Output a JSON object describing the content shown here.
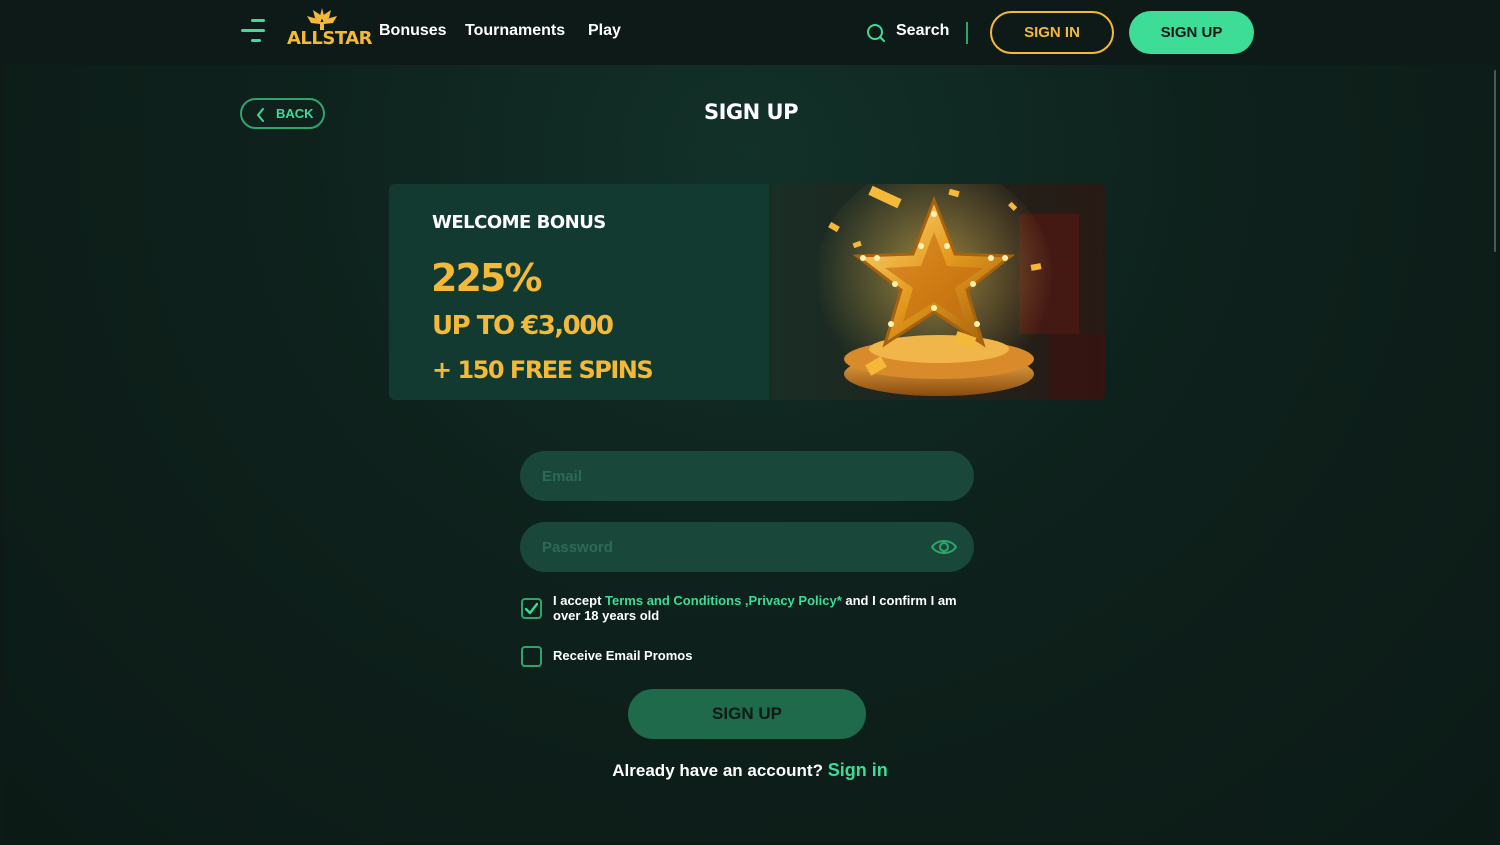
{
  "header": {
    "logo_text": "ALLSTAR",
    "nav": [
      "Bonuses",
      "Tournaments",
      "Play"
    ],
    "search_label": "Search",
    "sign_in_label": "SIGN IN",
    "sign_up_label": "SIGN UP"
  },
  "page": {
    "back_label": "BACK",
    "title": "SIGN UP"
  },
  "banner": {
    "title": "WELCOME BONUS",
    "percent": "225%",
    "amount": "UP TO €3,000",
    "spins": "+ 150 FREE SPINS"
  },
  "form": {
    "email_placeholder": "Email",
    "password_placeholder": "Password",
    "terms_prefix": "I accept ",
    "terms_link": "Terms and Conditions",
    "privacy_link": " ,Privacy Policy*",
    "terms_suffix": " and I confirm I am over 18 years old",
    "terms_checked": true,
    "promo_label": "Receive Email Promos",
    "promo_checked": false,
    "submit_label": "SIGN UP",
    "already_text": "Already have an account?",
    "sign_in_link": "Sign in"
  },
  "colors": {
    "accent": "#3ddc97",
    "gold": "#f5b93a",
    "background": "#0d1a17",
    "input": "#19473a"
  },
  "icons": [
    "menu-icon",
    "search-icon",
    "chevron-left-icon",
    "eye-icon",
    "check-icon"
  ]
}
